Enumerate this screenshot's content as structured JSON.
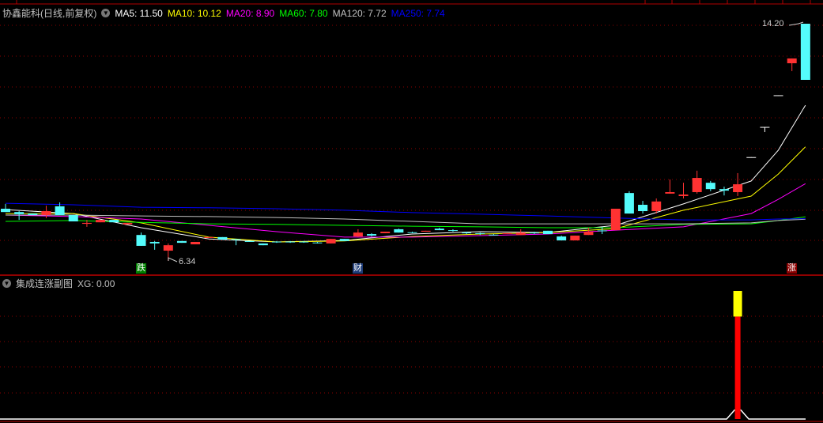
{
  "header": {
    "stock_name": "协鑫能科(日线,前复权)",
    "ma_labels": [
      {
        "text": "MA5: 11.50",
        "color": "#ffffff"
      },
      {
        "text": "MA10: 10.12",
        "color": "#ffff00"
      },
      {
        "text": "MA20: 8.90",
        "color": "#ff00ff"
      },
      {
        "text": "MA60: 7.80",
        "color": "#00ff00"
      },
      {
        "text": "MA120: 7.72",
        "color": "#c0c0c0"
      },
      {
        "text": "MA250: 7.74",
        "color": "#0000ff"
      }
    ]
  },
  "sub_header": {
    "title": "集成连涨副图",
    "xg": "XG: 0.00"
  },
  "markers": {
    "high_label": "14.20",
    "low_label": "6.34",
    "tag_fall": "跌",
    "tag_finance": "财",
    "tag_rise": "涨"
  },
  "colors": {
    "up": "#ff3232",
    "down": "#54fcfc",
    "flat": "#ffffff",
    "grid": "#8b0000",
    "border": "#b00000"
  },
  "chart_data": [
    {
      "type": "candlestick",
      "title": "协鑫能科(日线,前复权)",
      "ylim": [
        6.34,
        14.2
      ],
      "candle_format": [
        "body_top",
        "body_bottom",
        "high",
        "low",
        "color"
      ],
      "candles": [
        [
          8.07,
          7.96,
          8.23,
          7.96,
          "c"
        ],
        [
          7.96,
          7.89,
          7.99,
          7.7,
          "c"
        ],
        [
          7.91,
          7.86,
          7.91,
          7.86,
          "c"
        ],
        [
          7.99,
          7.86,
          8.17,
          7.76,
          "r"
        ],
        [
          8.15,
          7.86,
          8.28,
          7.86,
          "c"
        ],
        [
          7.86,
          7.65,
          7.86,
          7.65,
          "c"
        ],
        [
          7.6,
          7.57,
          7.7,
          7.47,
          "r"
        ],
        [
          7.7,
          7.62,
          7.7,
          7.62,
          "r"
        ],
        [
          7.7,
          7.62,
          7.7,
          7.62,
          "c"
        ],
        [
          7.6,
          7.55,
          7.6,
          7.55,
          "r"
        ],
        [
          7.2,
          6.84,
          7.28,
          6.84,
          "c"
        ],
        [
          6.97,
          6.92,
          7.0,
          6.71,
          "c"
        ],
        [
          6.86,
          6.68,
          6.92,
          6.34,
          "r"
        ],
        [
          7.0,
          6.94,
          7.0,
          6.94,
          "c"
        ],
        [
          6.97,
          6.89,
          6.97,
          6.89,
          "r"
        ],
        [
          7.13,
          7.1,
          7.13,
          7.1,
          "r"
        ],
        [
          7.13,
          7.05,
          7.13,
          7.05,
          "c"
        ],
        [
          7.06,
          7.05,
          7.07,
          6.86,
          "c"
        ],
        [
          7.0,
          6.97,
          7.0,
          6.97,
          "c"
        ],
        [
          6.92,
          6.86,
          6.92,
          6.86,
          "c"
        ],
        [
          6.98,
          6.97,
          7.0,
          6.94,
          "c"
        ],
        [
          6.98,
          6.97,
          7.0,
          6.94,
          "c"
        ],
        [
          6.98,
          6.97,
          7.0,
          6.94,
          "c"
        ],
        [
          6.95,
          6.94,
          6.97,
          6.92,
          "c"
        ],
        [
          7.07,
          6.92,
          7.07,
          6.92,
          "r"
        ],
        [
          7.07,
          7.0,
          7.07,
          7.0,
          "c"
        ],
        [
          7.28,
          7.15,
          7.39,
          7.13,
          "r"
        ],
        [
          7.23,
          7.18,
          7.26,
          7.15,
          "c"
        ],
        [
          7.31,
          7.26,
          7.31,
          7.26,
          "r"
        ],
        [
          7.39,
          7.28,
          7.41,
          7.28,
          "c"
        ],
        [
          7.29,
          7.28,
          7.31,
          7.26,
          "c"
        ],
        [
          7.34,
          7.31,
          7.34,
          7.31,
          "r"
        ],
        [
          7.41,
          7.36,
          7.44,
          7.36,
          "c"
        ],
        [
          7.36,
          7.34,
          7.39,
          7.31,
          "c"
        ],
        [
          7.28,
          7.26,
          7.31,
          7.23,
          "c"
        ],
        [
          7.26,
          7.24,
          7.28,
          7.2,
          "c"
        ],
        [
          7.21,
          7.2,
          7.23,
          7.18,
          "c"
        ],
        [
          7.26,
          7.23,
          7.26,
          7.23,
          "r"
        ],
        [
          7.28,
          7.2,
          7.39,
          7.2,
          "r"
        ],
        [
          7.28,
          7.26,
          7.31,
          7.23,
          "c"
        ],
        [
          7.34,
          7.23,
          7.34,
          7.23,
          "c"
        ],
        [
          7.15,
          7.02,
          7.18,
          7.02,
          "c"
        ],
        [
          7.18,
          7.02,
          7.18,
          7.02,
          "r"
        ],
        [
          7.31,
          7.2,
          7.44,
          7.2,
          "r"
        ],
        [
          7.35,
          7.33,
          7.47,
          7.23,
          "c"
        ],
        [
          8.07,
          7.36,
          8.07,
          7.36,
          "r"
        ],
        [
          8.59,
          7.91,
          8.65,
          7.91,
          "c"
        ],
        [
          8.2,
          7.99,
          8.33,
          7.91,
          "c"
        ],
        [
          8.31,
          7.99,
          8.41,
          7.91,
          "r"
        ],
        [
          8.62,
          8.57,
          9.04,
          8.57,
          "r"
        ],
        [
          8.54,
          8.49,
          8.93,
          8.41,
          "r"
        ],
        [
          9.09,
          8.62,
          9.33,
          8.57,
          "r"
        ],
        [
          8.93,
          8.72,
          8.99,
          8.65,
          "c"
        ],
        [
          8.72,
          8.67,
          8.8,
          8.51,
          "c"
        ],
        [
          8.88,
          8.62,
          9.25,
          8.49,
          "r"
        ],
        [
          9.78,
          9.76,
          9.78,
          9.76,
          "w"
        ],
        [
          10.78,
          10.76,
          10.78,
          10.61,
          "w"
        ],
        [
          11.83,
          11.81,
          11.83,
          11.81,
          "w"
        ],
        [
          13.05,
          12.89,
          13.05,
          12.63,
          "r"
        ],
        [
          14.2,
          12.34,
          14.2,
          12.34,
          "c"
        ]
      ],
      "ma_sample_index": [
        0,
        5,
        10,
        15,
        20,
        25,
        30,
        35,
        40,
        45,
        50,
        55,
        57,
        59
      ],
      "series": [
        {
          "name": "MA5",
          "color": "#ffffff",
          "values": [
            8.04,
            7.91,
            7.44,
            7.07,
            6.97,
            7.02,
            7.23,
            7.31,
            7.28,
            7.52,
            8.23,
            8.99,
            10.01,
            11.5
          ]
        },
        {
          "name": "MA10",
          "color": "#ffff00",
          "values": [
            7.91,
            7.91,
            7.6,
            7.13,
            6.97,
            7.0,
            7.15,
            7.23,
            7.28,
            7.41,
            8.02,
            8.49,
            9.22,
            10.12
          ]
        },
        {
          "name": "MA20",
          "color": "#ff00ff",
          "values": [
            7.86,
            7.81,
            7.73,
            7.52,
            7.31,
            7.13,
            7.13,
            7.18,
            7.23,
            7.36,
            7.47,
            7.91,
            8.38,
            8.9
          ]
        },
        {
          "name": "MA60",
          "color": "#00ff00",
          "values": [
            7.65,
            7.68,
            7.62,
            7.57,
            7.55,
            7.52,
            7.49,
            7.47,
            7.44,
            7.44,
            7.55,
            7.57,
            7.68,
            7.8
          ]
        },
        {
          "name": "MA120",
          "color": "#c0c0c0",
          "values": [
            7.86,
            7.86,
            7.83,
            7.81,
            7.78,
            7.73,
            7.65,
            7.57,
            7.57,
            7.57,
            7.57,
            7.6,
            7.68,
            7.72
          ]
        },
        {
          "name": "MA250",
          "color": "#0000ff",
          "values": [
            8.25,
            8.2,
            8.12,
            8.1,
            8.07,
            8.02,
            7.94,
            7.89,
            7.83,
            7.76,
            7.7,
            7.7,
            7.73,
            7.74
          ]
        }
      ]
    },
    {
      "type": "bar",
      "title": "集成连涨副图",
      "ylim": [
        0,
        100
      ],
      "signal_index": 54,
      "red_value": 80,
      "yellow_value": 100,
      "line_baseline": 0,
      "line_peak": 7
    }
  ]
}
